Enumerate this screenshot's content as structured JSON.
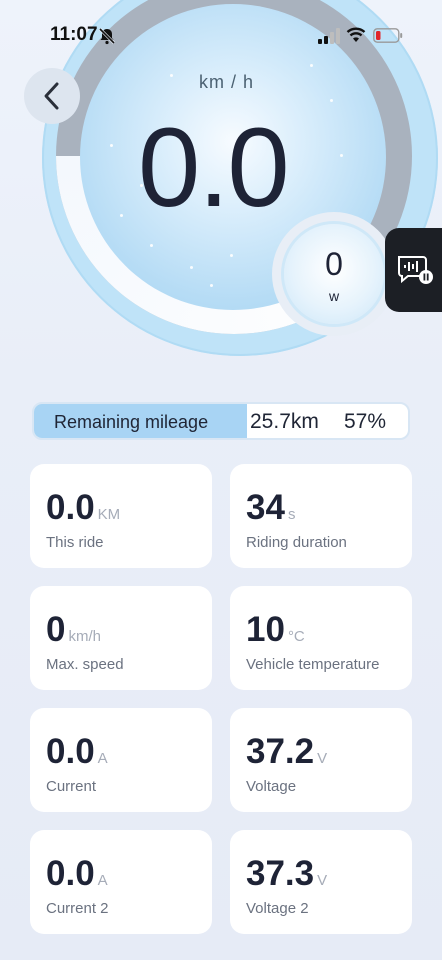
{
  "status_bar": {
    "time": "11:07",
    "icons": [
      "bell-off-icon",
      "signal-icon",
      "wifi-icon",
      "battery-low-icon"
    ]
  },
  "gauge": {
    "unit": "km / h",
    "speed": "0.0",
    "power": {
      "value": "0",
      "unit": "w"
    }
  },
  "header": {
    "back_icon": "chevron-left-icon"
  },
  "voice_button": {
    "icon": "voice-pause-icon"
  },
  "mileage": {
    "label": "Remaining mileage",
    "distance": "25.7km",
    "percent": "57%",
    "fill_fraction": 0.57
  },
  "stats": [
    {
      "value": "0.0",
      "unit": "KM",
      "label": "This ride"
    },
    {
      "value": "34",
      "unit": "s",
      "label": "Riding duration"
    },
    {
      "value": "0",
      "unit": "km/h",
      "label": "Max. speed"
    },
    {
      "value": "10",
      "unit": "°C",
      "label": "Vehicle temperature"
    },
    {
      "value": "0.0",
      "unit": "A",
      "label": "Current"
    },
    {
      "value": "37.2",
      "unit": "V",
      "label": "Voltage"
    },
    {
      "value": "0.0",
      "unit": "A",
      "label": "Current 2"
    },
    {
      "value": "37.3",
      "unit": "V",
      "label": "Voltage 2"
    }
  ],
  "colors": {
    "accent": "#a8d4f4",
    "text_primary": "#1e2336",
    "text_secondary": "#6b7280",
    "unit_gray": "#a6acb8"
  }
}
